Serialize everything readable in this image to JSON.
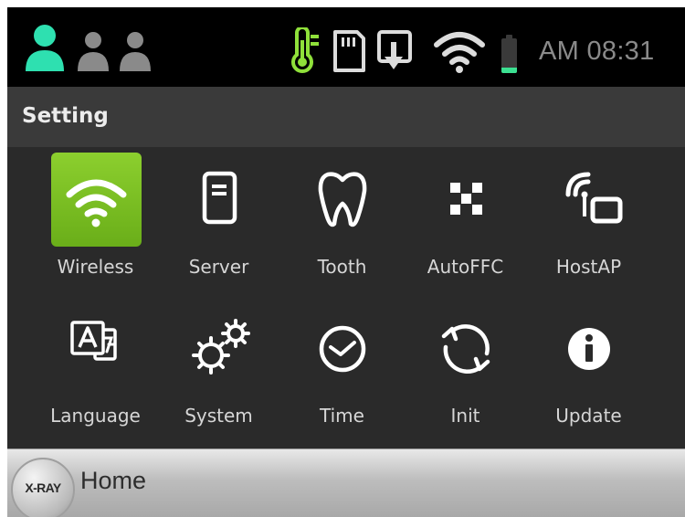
{
  "status_bar": {
    "clock": "AM 08:31",
    "battery_level": 0.15,
    "colors": {
      "active_user": "#2ee0b0",
      "inactive_user": "#8a8a8a",
      "thermometer": "#8fe03a",
      "battery": "#3be091"
    },
    "icons": [
      "user-active-icon",
      "user-inactive-icon",
      "user-inactive-icon",
      "thermometer-icon",
      "sd-card-icon",
      "tablet-download-icon",
      "wifi-icon",
      "battery-icon"
    ]
  },
  "title_bar": {
    "title": "Setting"
  },
  "settings_grid": {
    "selected": "Wireless",
    "selected_color": "#7cc124",
    "items": [
      {
        "label": "Wireless",
        "icon": "wifi-icon"
      },
      {
        "label": "Server",
        "icon": "server-icon"
      },
      {
        "label": "Tooth",
        "icon": "tooth-icon"
      },
      {
        "label": "AutoFFC",
        "icon": "checkerboard-icon"
      },
      {
        "label": "HostAP",
        "icon": "hotspot-icon"
      },
      {
        "label": "Language",
        "icon": "language-icon"
      },
      {
        "label": "System",
        "icon": "gears-icon"
      },
      {
        "label": "Time",
        "icon": "clock-icon"
      },
      {
        "label": "Init",
        "icon": "reset-icon"
      },
      {
        "label": "Update",
        "icon": "info-icon"
      }
    ]
  },
  "home_bar": {
    "xray_label": "X-RAY",
    "home_label": "Home"
  }
}
